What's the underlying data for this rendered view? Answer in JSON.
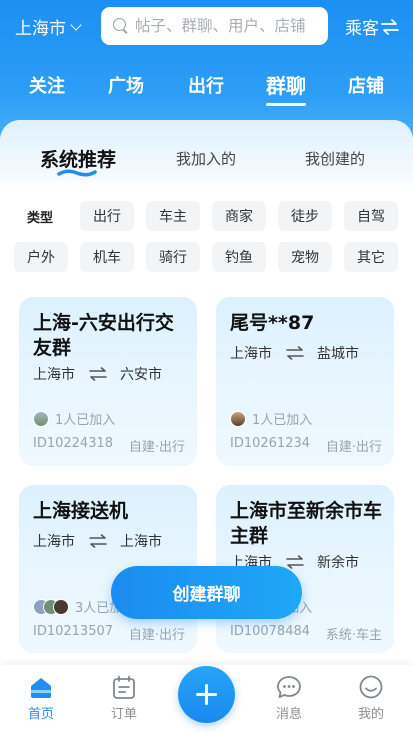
{
  "topbar": {
    "city": "上海市",
    "search_placeholder": "帖子、群聊、用户、店铺",
    "role": "乘客"
  },
  "main_tabs": [
    {
      "label": "关注",
      "active": false
    },
    {
      "label": "广场",
      "active": false
    },
    {
      "label": "出行",
      "active": false
    },
    {
      "label": "群聊",
      "active": true
    },
    {
      "label": "店铺",
      "active": false
    }
  ],
  "sub_tabs": [
    {
      "label": "系统推荐",
      "active": true
    },
    {
      "label": "我加入的",
      "active": false
    },
    {
      "label": "我创建的",
      "active": false
    }
  ],
  "filters": {
    "label": "类型",
    "row1": [
      "出行",
      "车主",
      "商家",
      "徒步",
      "自驾"
    ],
    "row2": [
      "户外",
      "机车",
      "骑行",
      "钓鱼",
      "宠物",
      "其它"
    ]
  },
  "cards": [
    {
      "title": "上海-六安出行交友群",
      "from": "上海市",
      "to": "六安市",
      "joined": "1人已加入",
      "id": "ID10224318",
      "tag": "自建·出行"
    },
    {
      "title": "尾号**87",
      "from": "上海市",
      "to": "盐城市",
      "joined": "1人已加入",
      "id": "ID10261234",
      "tag": "自建·出行"
    },
    {
      "title": "上海接送机",
      "from": "上海市",
      "to": "上海市",
      "joined": "3人已加入",
      "id": "ID10213507",
      "tag": "自建·出行"
    },
    {
      "title": "上海市至新余市车主群",
      "from": "上海市",
      "to": "新余市",
      "joined": "1人已加入",
      "id": "ID10078484",
      "tag": "系统·车主"
    }
  ],
  "create_button": "创建群聊",
  "bottom_nav": [
    {
      "label": "首页",
      "icon": "home-icon",
      "active": true
    },
    {
      "label": "订单",
      "icon": "calendar-icon",
      "active": false
    },
    {
      "label": "消息",
      "icon": "chat-icon",
      "active": false
    },
    {
      "label": "我的",
      "icon": "smile-icon",
      "active": false
    }
  ],
  "colors": {
    "accent": "#1e8ef2",
    "header_top": "#1c8ff2",
    "card_bg": "#dcf1fd"
  }
}
